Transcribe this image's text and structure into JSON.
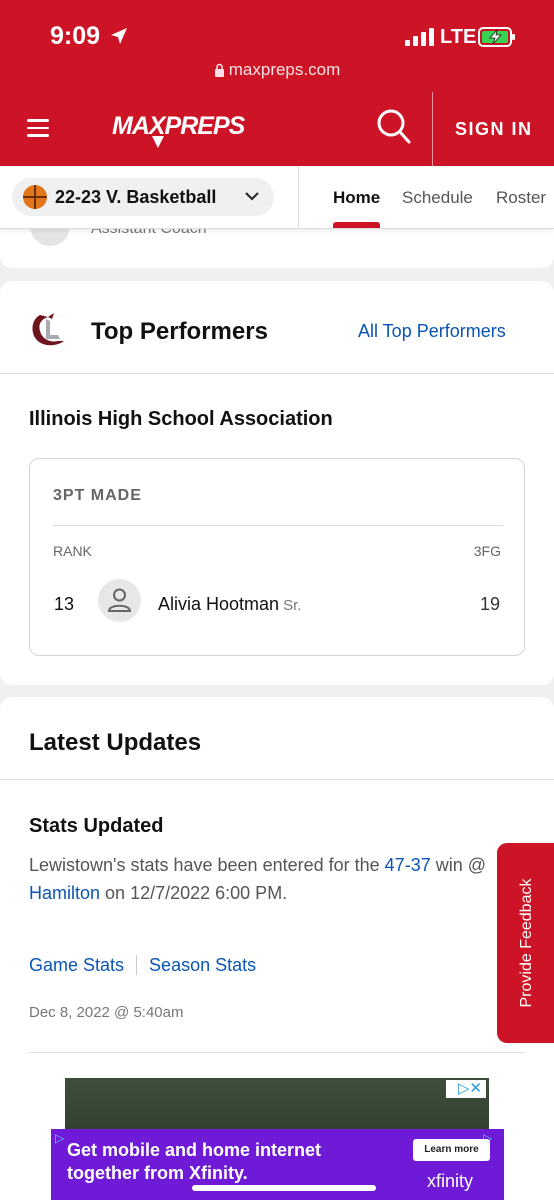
{
  "status": {
    "time": "9:09",
    "network": "LTE"
  },
  "browser": {
    "url": "maxpreps.com"
  },
  "header": {
    "logo_text": "MAXPREPS",
    "signin_label": "SIGN IN"
  },
  "team_nav": {
    "sport": "22-23 V. Basketball",
    "tabs": [
      {
        "label": "Home"
      },
      {
        "label": "Schedule"
      },
      {
        "label": "Roster"
      }
    ]
  },
  "staff": {
    "role": "Assistant Coach"
  },
  "top_performers": {
    "title": "Top Performers",
    "link": "All Top Performers",
    "association": "Illinois High School Association",
    "stat": {
      "title": "3PT MADE",
      "rank_header": "RANK",
      "value_header": "3FG",
      "rank": "13",
      "player_name": "Alivia Hootman",
      "player_class": "Sr.",
      "value": "19"
    }
  },
  "latest_updates": {
    "title": "Latest Updates",
    "item": {
      "title": "Stats Updated",
      "text_1": "Lewistown's stats have been entered for the",
      "score": "47-37",
      "text_2": "win @",
      "opponent": "Hamilton",
      "text_3": "on 12/7/2022 6:00 PM.",
      "game_stats_link": "Game Stats",
      "season_stats_link": "Season Stats",
      "date": "Dec 8, 2022 @ 5:40am"
    }
  },
  "feedback": {
    "label": "Provide Feedback"
  },
  "ad": {
    "text": "Get mobile and home internet together from Xfinity.",
    "button": "Learn more",
    "brand": "xfinity"
  },
  "colors": {
    "brand_red": "#cc1426",
    "link_blue": "#0a55b5",
    "ad_purple": "#6e1ad6"
  }
}
